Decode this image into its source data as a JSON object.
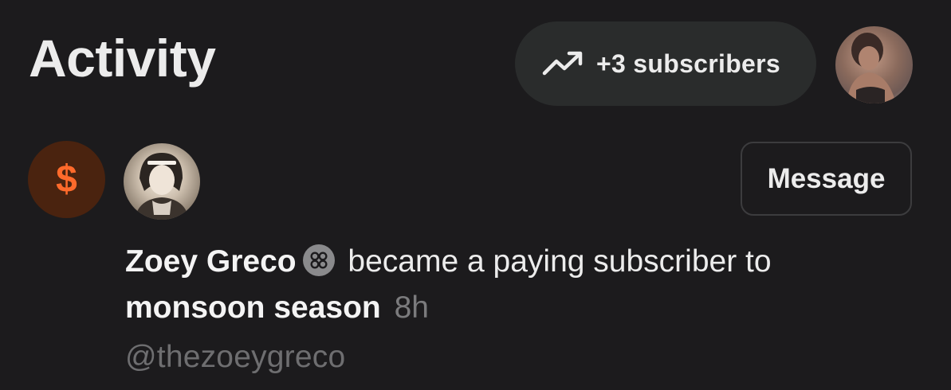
{
  "header": {
    "title": "Activity"
  },
  "subscribers_pill": {
    "label": "+3 subscribers",
    "icon": "trending-up-icon"
  },
  "activity_item": {
    "badge_symbol": "$",
    "badge_color": "#ff6a2b",
    "message_button_label": "Message",
    "user_name": "Zoey Greco",
    "action_text": "became a paying subscriber to",
    "publication": "monsoon season",
    "time_ago": "8h",
    "handle": "@thezoeygreco"
  },
  "colors": {
    "background": "#1c1b1d",
    "pill_background": "#2a2c2c",
    "accent_orange": "#ff6a2b",
    "muted_text": "#6e6e70"
  }
}
